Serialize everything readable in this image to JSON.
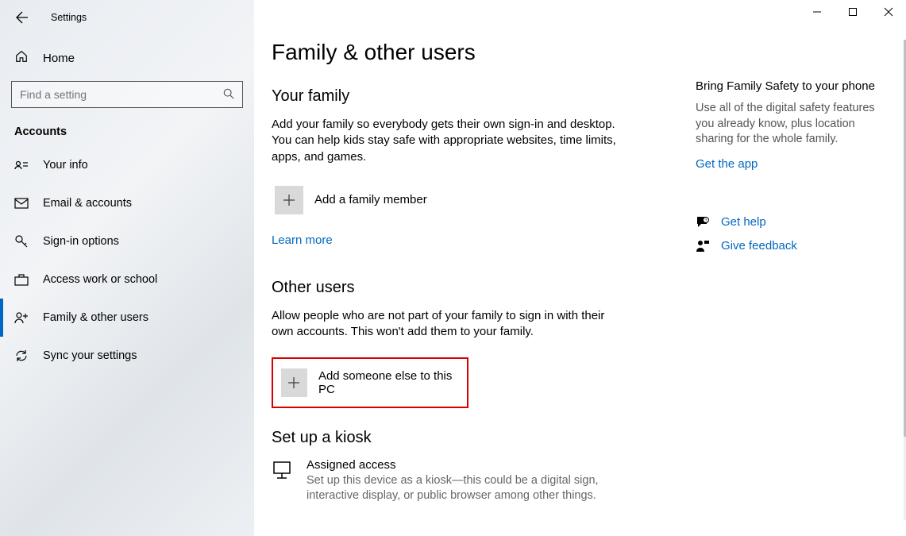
{
  "app": {
    "title": "Settings"
  },
  "home": {
    "label": "Home"
  },
  "search": {
    "placeholder": "Find a setting"
  },
  "section_header": "Accounts",
  "nav": [
    {
      "id": "your-info",
      "label": "Your info",
      "selected": false
    },
    {
      "id": "email-accounts",
      "label": "Email & accounts",
      "selected": false
    },
    {
      "id": "signin-options",
      "label": "Sign-in options",
      "selected": false
    },
    {
      "id": "access-work-school",
      "label": "Access work or school",
      "selected": false
    },
    {
      "id": "family-other-users",
      "label": "Family & other users",
      "selected": true
    },
    {
      "id": "sync-settings",
      "label": "Sync your settings",
      "selected": false
    }
  ],
  "page": {
    "title": "Family & other users",
    "family": {
      "heading": "Your family",
      "text": "Add your family so everybody gets their own sign-in and desktop. You can help kids stay safe with appropriate websites, time limits, apps, and games.",
      "add_label": "Add a family member",
      "learn_more": "Learn more"
    },
    "other_users": {
      "heading": "Other users",
      "text": "Allow people who are not part of your family to sign in with their own accounts. This won't add them to your family.",
      "add_label": "Add someone else to this PC"
    },
    "kiosk": {
      "heading": "Set up a kiosk",
      "title": "Assigned access",
      "desc": "Set up this device as a kiosk—this could be a digital sign, interactive display, or public browser among other things."
    }
  },
  "info": {
    "title": "Bring Family Safety to your phone",
    "text": "Use all of the digital safety features you already know, plus location sharing for the whole family.",
    "get_app": "Get the app"
  },
  "help": {
    "get_help": "Get help",
    "give_feedback": "Give feedback"
  }
}
